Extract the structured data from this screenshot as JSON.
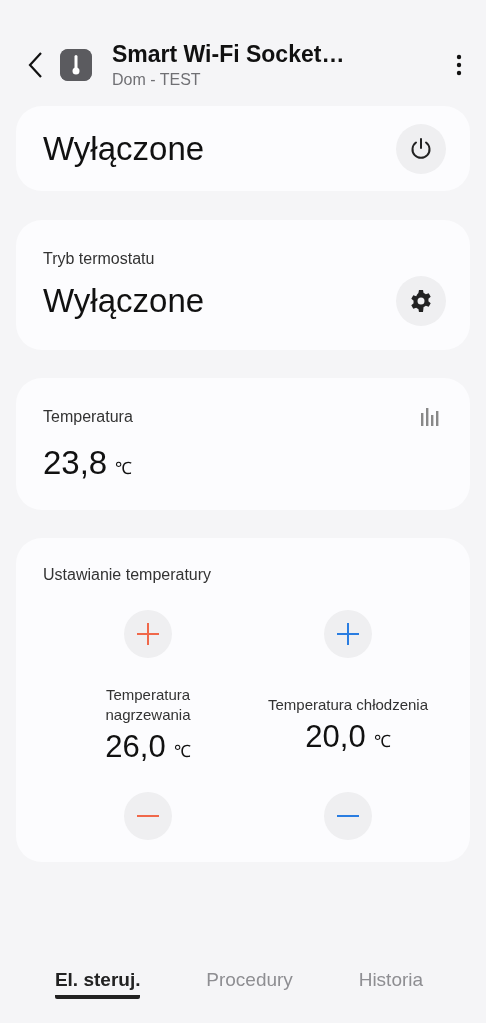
{
  "header": {
    "title": "Smart Wi-Fi Socket…",
    "subtitle": "Dom - TEST"
  },
  "power_card": {
    "state": "Wyłączone"
  },
  "mode_card": {
    "label": "Tryb termostatu",
    "value": "Wyłączone"
  },
  "temperature_card": {
    "label": "Temperatura",
    "value": "23,8",
    "unit": "℃"
  },
  "setpoint_card": {
    "label": "Ustawianie temperatury",
    "setpoints": [
      {
        "label": "Temperatura nagrzewania",
        "value": "26,0",
        "unit": "℃",
        "color": "#f0684a"
      },
      {
        "label": "Temperatura chłodzenia",
        "value": "20,0",
        "unit": "℃",
        "color": "#2a7de1"
      }
    ]
  },
  "tabs": [
    {
      "label": "El. steruj.",
      "selected": true
    },
    {
      "label": "Procedury",
      "selected": false
    },
    {
      "label": "Historia",
      "selected": false
    }
  ]
}
